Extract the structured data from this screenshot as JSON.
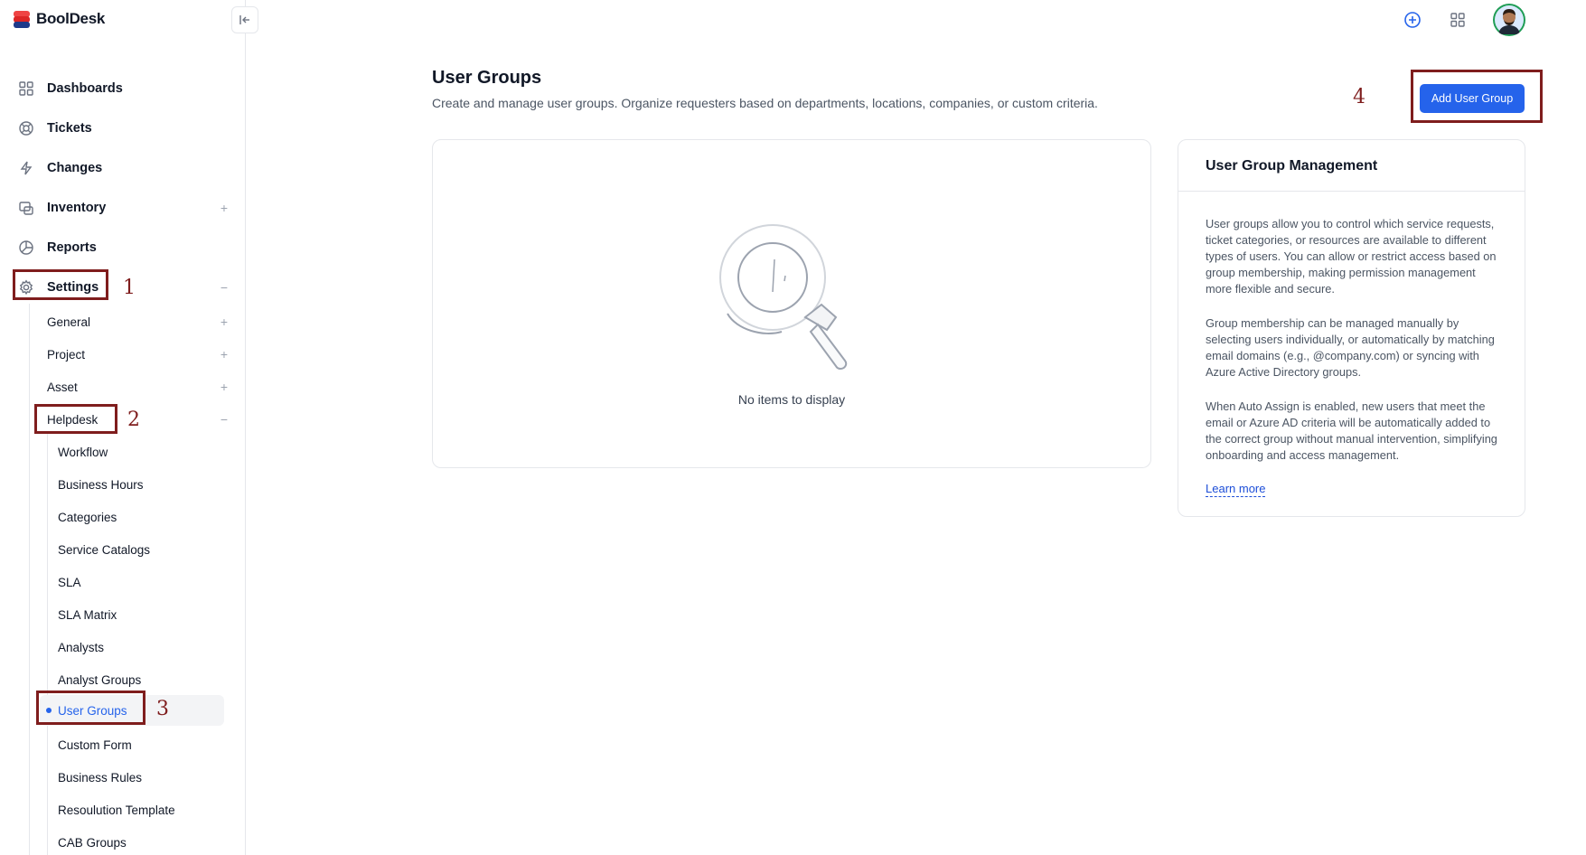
{
  "brand": {
    "name": "BoolDesk"
  },
  "nav": {
    "dashboards": "Dashboards",
    "tickets": "Tickets",
    "changes": "Changes",
    "inventory": "Inventory",
    "reports": "Reports",
    "settings": "Settings",
    "expand_symbol": "+",
    "collapse_symbol": "−"
  },
  "settings_sub": {
    "general": "General",
    "project": "Project",
    "asset": "Asset",
    "helpdesk": "Helpdesk"
  },
  "helpdesk_sub": [
    "Workflow",
    "Business Hours",
    "Categories",
    "Service Catalogs",
    "SLA",
    "SLA Matrix",
    "Analysts",
    "Analyst Groups",
    "User Groups",
    "Custom Form",
    "Business Rules",
    "Resoulution Template",
    "CAB Groups"
  ],
  "annotations": [
    "1",
    "2",
    "3",
    "4"
  ],
  "page": {
    "title": "User Groups",
    "description": "Create and manage user groups. Organize requesters based on departments, locations, companies, or custom criteria.",
    "add_button": "Add User Group",
    "empty_text": "No items to display"
  },
  "info": {
    "title": "User Group Management",
    "para1": "User groups allow you to control which service requests, ticket categories, or resources are available to different types of users. You can allow or restrict access based on group membership, making permission management more flexible and secure.",
    "para2": "Group membership can be managed manually by selecting users individually, or automatically by matching email domains (e.g., @company.com) or syncing with Azure Active Directory groups.",
    "para3": "When Auto Assign is enabled, new users that meet the email or Azure AD criteria will be automatically added to the correct group without manual intervention, simplifying onboarding and access management.",
    "link": "Learn more"
  },
  "colors": {
    "primary": "#2563eb",
    "annotation": "#7f1d1d"
  }
}
